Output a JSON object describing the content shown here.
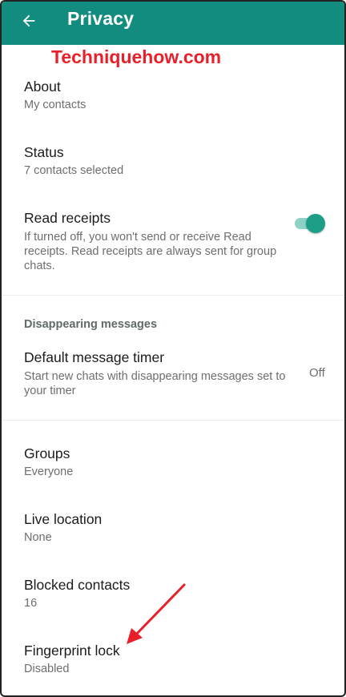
{
  "appbar": {
    "title": "Privacy",
    "color": "#128c7e"
  },
  "watermark": "Techniquehow.com",
  "rows": {
    "about": {
      "title": "About",
      "value": "My contacts"
    },
    "status": {
      "title": "Status",
      "value": "7 contacts selected"
    },
    "read_receipts": {
      "title": "Read receipts",
      "description": "If turned off, you won't send or receive Read receipts. Read receipts are always sent for group chats.",
      "enabled": true
    },
    "disappearing_section": "Disappearing messages",
    "default_timer": {
      "title": "Default message timer",
      "description": "Start new chats with disappearing messages set to your timer",
      "value": "Off"
    },
    "groups": {
      "title": "Groups",
      "value": "Everyone"
    },
    "live_location": {
      "title": "Live location",
      "value": "None"
    },
    "blocked_contacts": {
      "title": "Blocked contacts",
      "value": "16"
    },
    "fingerprint_lock": {
      "title": "Fingerprint lock",
      "value": "Disabled"
    }
  },
  "icons": {
    "back": "arrow-back-icon"
  },
  "colors": {
    "accent": "#1d9e87",
    "annotation": "#e8202a"
  }
}
